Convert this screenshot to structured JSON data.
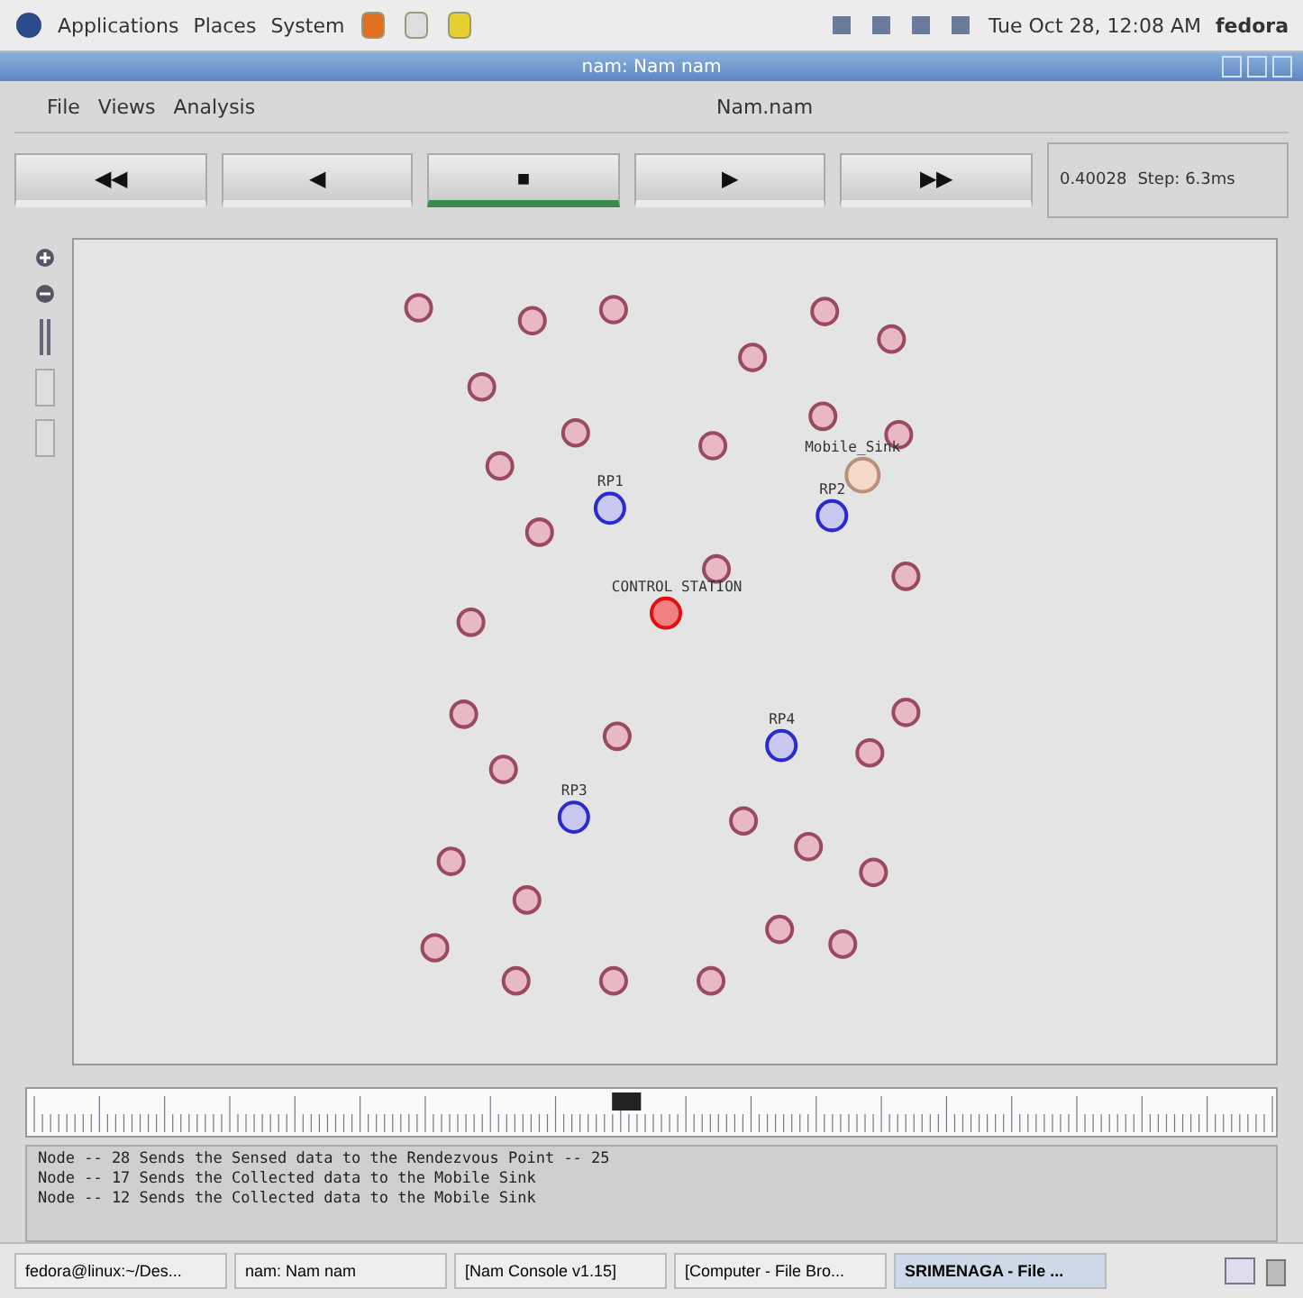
{
  "top_panel": {
    "menus": [
      "Applications",
      "Places",
      "System"
    ],
    "clock": "Tue Oct 28, 12:08 AM",
    "user": "fedora"
  },
  "window": {
    "title": "nam: Nam nam"
  },
  "menubar": {
    "items": [
      "File",
      "Views",
      "Analysis"
    ],
    "file_name": "Nam.nam"
  },
  "playback": {
    "buttons": [
      {
        "label": "◀◀",
        "selected": false
      },
      {
        "label": "◀",
        "selected": false
      },
      {
        "label": "■",
        "selected": true
      },
      {
        "label": "▶",
        "selected": false
      },
      {
        "label": "▶▶",
        "selected": false
      }
    ],
    "time": "0.40028",
    "step": "Step: 6.3ms"
  },
  "nodes": [
    {
      "kind": "sensor"
    },
    {
      "kind": "sensor"
    },
    {
      "kind": "sensor"
    },
    {
      "kind": "sensor"
    },
    {
      "kind": "sensor"
    },
    {
      "kind": "sensor"
    },
    {
      "kind": "sensor"
    },
    {
      "kind": "sensor"
    },
    {
      "kind": "sensor"
    },
    {
      "kind": "sensor"
    },
    {
      "kind": "sensor"
    },
    {
      "kind": "sensor"
    },
    {
      "kind": "sensor"
    },
    {
      "kind": "sensor"
    },
    {
      "kind": "sensor"
    },
    {
      "kind": "sensor"
    },
    {
      "kind": "sensor"
    },
    {
      "kind": "sensor"
    },
    {
      "kind": "sensor"
    },
    {
      "kind": "sensor"
    },
    {
      "kind": "sensor"
    },
    {
      "kind": "sensor"
    },
    {
      "kind": "sensor"
    },
    {
      "kind": "sensor"
    },
    {
      "kind": "sensor"
    },
    {
      "kind": "sensor"
    },
    {
      "kind": "sensor"
    },
    {
      "kind": "sensor"
    },
    {
      "kind": "sensor"
    },
    {
      "kind": "sensor"
    },
    {
      "kind": "sensor"
    },
    {
      "kind": "sensor"
    },
    {
      "kind": "rendezvous",
      "label": "RP1"
    },
    {
      "kind": "rendezvous",
      "label": "RP2"
    },
    {
      "kind": "rendezvous",
      "label": "RP4"
    },
    {
      "kind": "rendezvous",
      "label": "RP3"
    },
    {
      "kind": "base",
      "label": "CONTROL STATION"
    },
    {
      "kind": "sink",
      "label": "Mobile_Sink"
    }
  ],
  "timeline": {
    "level": 0.48
  },
  "log": [
    "Node -- 28 Sends the Sensed data to the Rendezvous Point -- 25",
    "Node -- 17 Sends the Collected data to the Mobile Sink",
    "Node -- 12 Sends the Collected data to the Mobile Sink"
  ],
  "taskbar": [
    {
      "label": "fedora@linux:~/Des...",
      "selected": false
    },
    {
      "label": "nam: Nam nam",
      "selected": false
    },
    {
      "label": "[Nam Console v1.15]",
      "selected": false
    },
    {
      "label": "[Computer - File Bro...",
      "selected": false
    },
    {
      "label": "SRIMENAGA - File ...",
      "selected": true
    }
  ]
}
